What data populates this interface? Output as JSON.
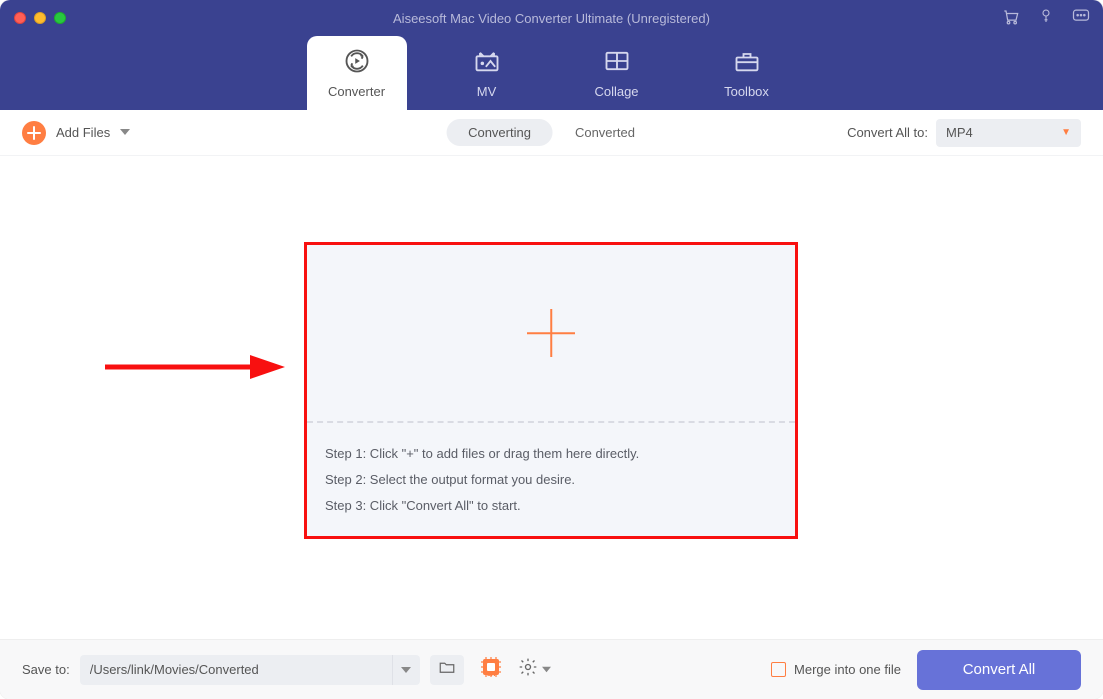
{
  "colors": {
    "header_bg": "#3a4290",
    "accent_orange": "#ff7e42",
    "primary_button": "#6772d8",
    "annotation_red": "#f81010"
  },
  "titlebar": {
    "title": "Aiseesoft Mac Video Converter Ultimate (Unregistered)"
  },
  "topnav": {
    "items": [
      {
        "label": "Converter",
        "icon": "convert-icon",
        "active": true
      },
      {
        "label": "MV",
        "icon": "mv-icon",
        "active": false
      },
      {
        "label": "Collage",
        "icon": "collage-icon",
        "active": false
      },
      {
        "label": "Toolbox",
        "icon": "toolbox-icon",
        "active": false
      }
    ]
  },
  "toolbar": {
    "add_files_label": "Add Files",
    "segmented": {
      "converting": "Converting",
      "converted": "Converted",
      "active": "Converting"
    },
    "convert_all_to_label": "Convert All to:",
    "format_selected": "MP4"
  },
  "dropzone": {
    "steps": [
      "Step 1: Click \"+\" to add files or drag them here directly.",
      "Step 2: Select the output format you desire.",
      "Step 3: Click \"Convert All\" to start."
    ]
  },
  "footer": {
    "save_to_label": "Save to:",
    "save_path": "/Users/link/Movies/Converted",
    "merge_label": "Merge into one file",
    "convert_all_button": "Convert All"
  }
}
